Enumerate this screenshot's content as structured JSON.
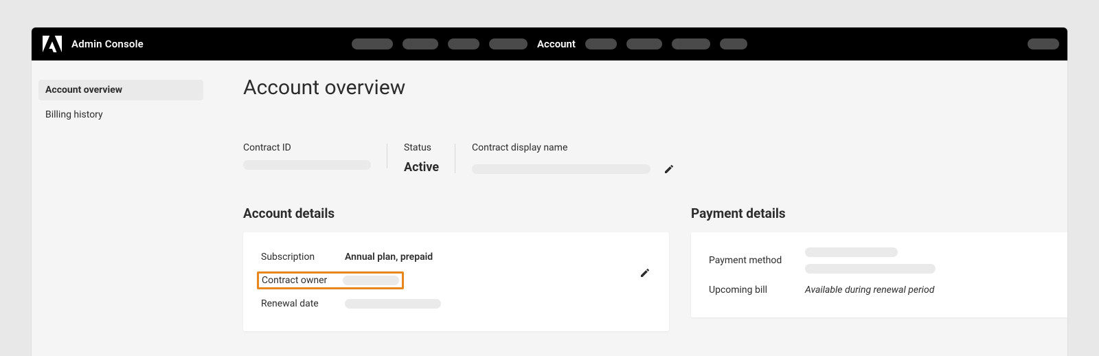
{
  "header": {
    "app_title": "Admin Console",
    "active_nav": "Account"
  },
  "sidebar": {
    "items": [
      {
        "label": "Account overview",
        "active": true
      },
      {
        "label": "Billing history",
        "active": false
      }
    ]
  },
  "page": {
    "title": "Account overview"
  },
  "contract": {
    "id_label": "Contract ID",
    "status_label": "Status",
    "status_value": "Active",
    "name_label": "Contract display name"
  },
  "account_details": {
    "title": "Account details",
    "subscription_label": "Subscription",
    "subscription_value": "Annual plan, prepaid",
    "contract_owner_label": "Contract owner",
    "renewal_label": "Renewal date"
  },
  "payment_details": {
    "title": "Payment details",
    "method_label": "Payment method",
    "upcoming_label": "Upcoming bill",
    "upcoming_value": "Available during renewal period"
  }
}
